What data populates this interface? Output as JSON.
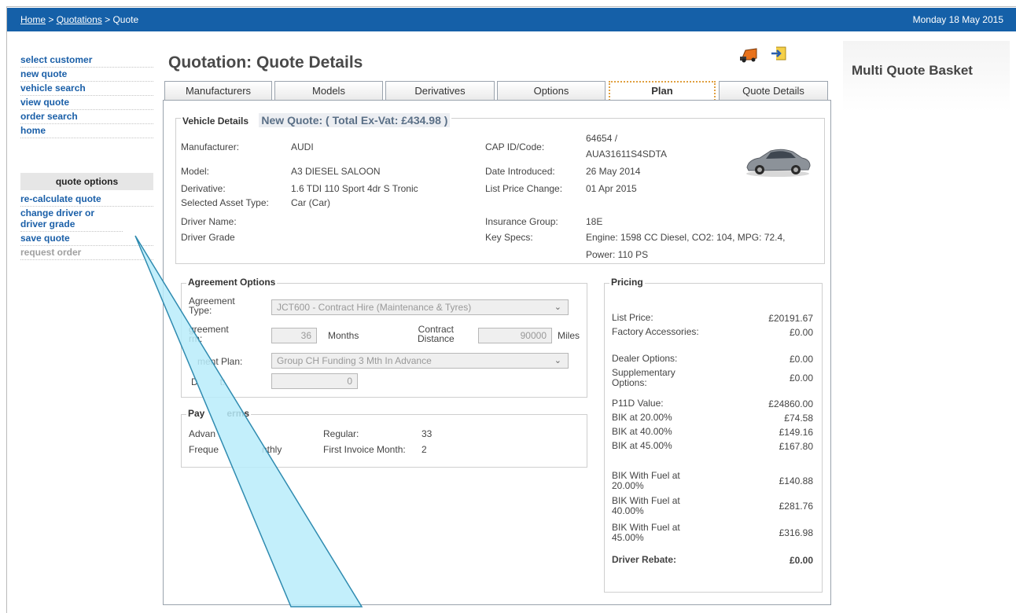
{
  "breadcrumb": {
    "home": "Home",
    "sep1": ">",
    "quotations": "Quotations",
    "sep2": ">",
    "current": "Quote"
  },
  "date": "Monday 18 May 2015",
  "leftnav": {
    "items": [
      "select customer",
      "new quote",
      "vehicle search",
      "view quote",
      "order search",
      "home"
    ],
    "options_header": "quote options",
    "options": [
      {
        "label": "re-calculate quote",
        "enabled": true
      },
      {
        "label": "change driver or driver grade",
        "enabled": true
      },
      {
        "label": "save quote",
        "enabled": true
      },
      {
        "label": "request order",
        "enabled": false
      }
    ]
  },
  "basket_title": "Multi Quote Basket",
  "page_title": "Quotation:  Quote Details",
  "icons": [
    "truck-icon",
    "export-icon"
  ],
  "tabs": [
    "Manufacturers",
    "Models",
    "Derivatives",
    "Options",
    "Plan",
    "Quote Details"
  ],
  "active_tab": "Plan",
  "vehicle": {
    "legend": "Vehicle Details",
    "quote_total": "New Quote: ( Total Ex-Vat: £434.98 )",
    "manufacturer_label": "Manufacturer:",
    "manufacturer": "AUDI",
    "model_label": "Model:",
    "model": "A3 DIESEL SALOON",
    "derivative_label": "Derivative:",
    "derivative": "1.6 TDI 110 Sport 4dr S Tronic",
    "asset_type_label": "Selected Asset Type:",
    "asset_type": "Car (Car)",
    "driver_name_label": "Driver Name:",
    "driver_name": "",
    "driver_grade_label": "Driver Grade",
    "driver_grade": "",
    "cap_label": "CAP ID/Code:",
    "cap_line1": "64654 /",
    "cap_line2": "AUA31611S4SDTA",
    "date_intro_label": "Date Introduced:",
    "date_intro": "26 May 2014",
    "list_change_label": "List Price Change:",
    "list_change": "01 Apr 2015",
    "insurance_label": "Insurance Group:",
    "insurance": "18E",
    "keyspecs_label": "Key Specs:",
    "keyspecs_line1": "Engine: 1598 CC Diesel, CO2: 104, MPG: 72.4,",
    "keyspecs_line2": "Power: 110 PS"
  },
  "agreement": {
    "legend": "Agreement Options",
    "type_label_1": "Agreement",
    "type_label_2": "Type:",
    "type_value": "JCT600 - Contract Hire (Maintenance & Tyres)",
    "term_label_1": "greement",
    "term_label_2": "rm:",
    "term_value": "36",
    "term_unit": "Months",
    "distance_label_1": "Contract",
    "distance_label_2": "Distance",
    "distance_value": "90000",
    "distance_unit": "Miles",
    "plan_label": "ment Plan:",
    "plan_value": "Group CH Funding 3 Mth In Advance",
    "deposit_label": "D",
    "deposit_label_2": "t:",
    "deposit_value": "0"
  },
  "payment": {
    "legend_1": "Pay",
    "legend_2": "erms",
    "advance_label": "Advan",
    "frequency_label": "Freque",
    "frequency_value": "nthly",
    "regular_label": "Regular:",
    "regular_value": "33",
    "first_invoice_label": "First Invoice Month:",
    "first_invoice_value": "2"
  },
  "pricing": {
    "legend": "Pricing",
    "rows": [
      {
        "label": "List Price:",
        "value": "£20191.67"
      },
      {
        "label": "Factory Accessories:",
        "value": "£0.00"
      },
      {
        "label": "Dealer Options:",
        "value": "£0.00"
      },
      {
        "label": "Supplementary Options:",
        "value": "£0.00"
      },
      {
        "label": "P11D Value:",
        "value": "£24860.00"
      },
      {
        "label": "BIK at 20.00%",
        "value": "£74.58"
      },
      {
        "label": "BIK at 40.00%",
        "value": "£149.16"
      },
      {
        "label": "BIK at 45.00%",
        "value": "£167.80"
      },
      {
        "label": "BIK With Fuel at 20.00%",
        "value": "£140.88"
      },
      {
        "label": "BIK With Fuel at 40.00%",
        "value": "£281.76"
      },
      {
        "label": "BIK With Fuel at 45.00%",
        "value": "£316.98"
      },
      {
        "label": "Driver Rebate:",
        "value": "£0.00"
      }
    ]
  },
  "colors": {
    "header_bar": "#1560a8",
    "link": "#1a5fa8",
    "callout_fill": "#b8ecfa",
    "callout_stroke": "#2f8bb0"
  }
}
